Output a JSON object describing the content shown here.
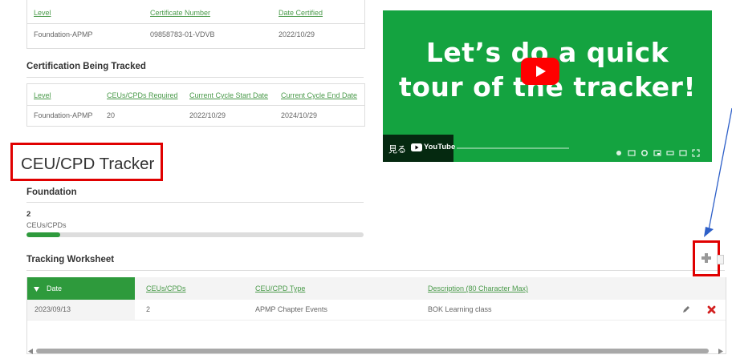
{
  "cert_table": {
    "headers": [
      "Level",
      "Certificate Number",
      "Date Certified"
    ],
    "row": [
      "Foundation-APMP",
      "09858783-01-VDVB",
      "2022/10/29"
    ]
  },
  "tracked": {
    "title": "Certification Being Tracked",
    "headers": [
      "Level",
      "CEUs/CPDs Required",
      "Current Cycle Start Date",
      "Current Cycle End Date"
    ],
    "row": [
      "Foundation-APMP",
      "20",
      "2022/10/29",
      "2024/10/29"
    ]
  },
  "video": {
    "line1": "Let’s do a quick",
    "line2": "tour of the tracker!",
    "watch_label": "見る",
    "youtube_label": "YouTube",
    "bg_color": "#14a340"
  },
  "tracker": {
    "title": "CEU/CPD Tracker",
    "level": "Foundation",
    "count": "2",
    "count_label": "CEUs/CPDs",
    "progress": 0.1
  },
  "worksheet": {
    "title": "Tracking Worksheet",
    "headers": [
      "Date",
      "CEUs/CPDs",
      "CEU/CPD Type",
      "Description (80 Character Max)"
    ],
    "row": [
      "2023/09/13",
      "2",
      "APMP Chapter Events",
      "BOK Learning class"
    ]
  },
  "colors": {
    "accent": "#2e9a3c",
    "annotation_red": "#e00000",
    "arrow_blue": "#2d5fc8"
  }
}
